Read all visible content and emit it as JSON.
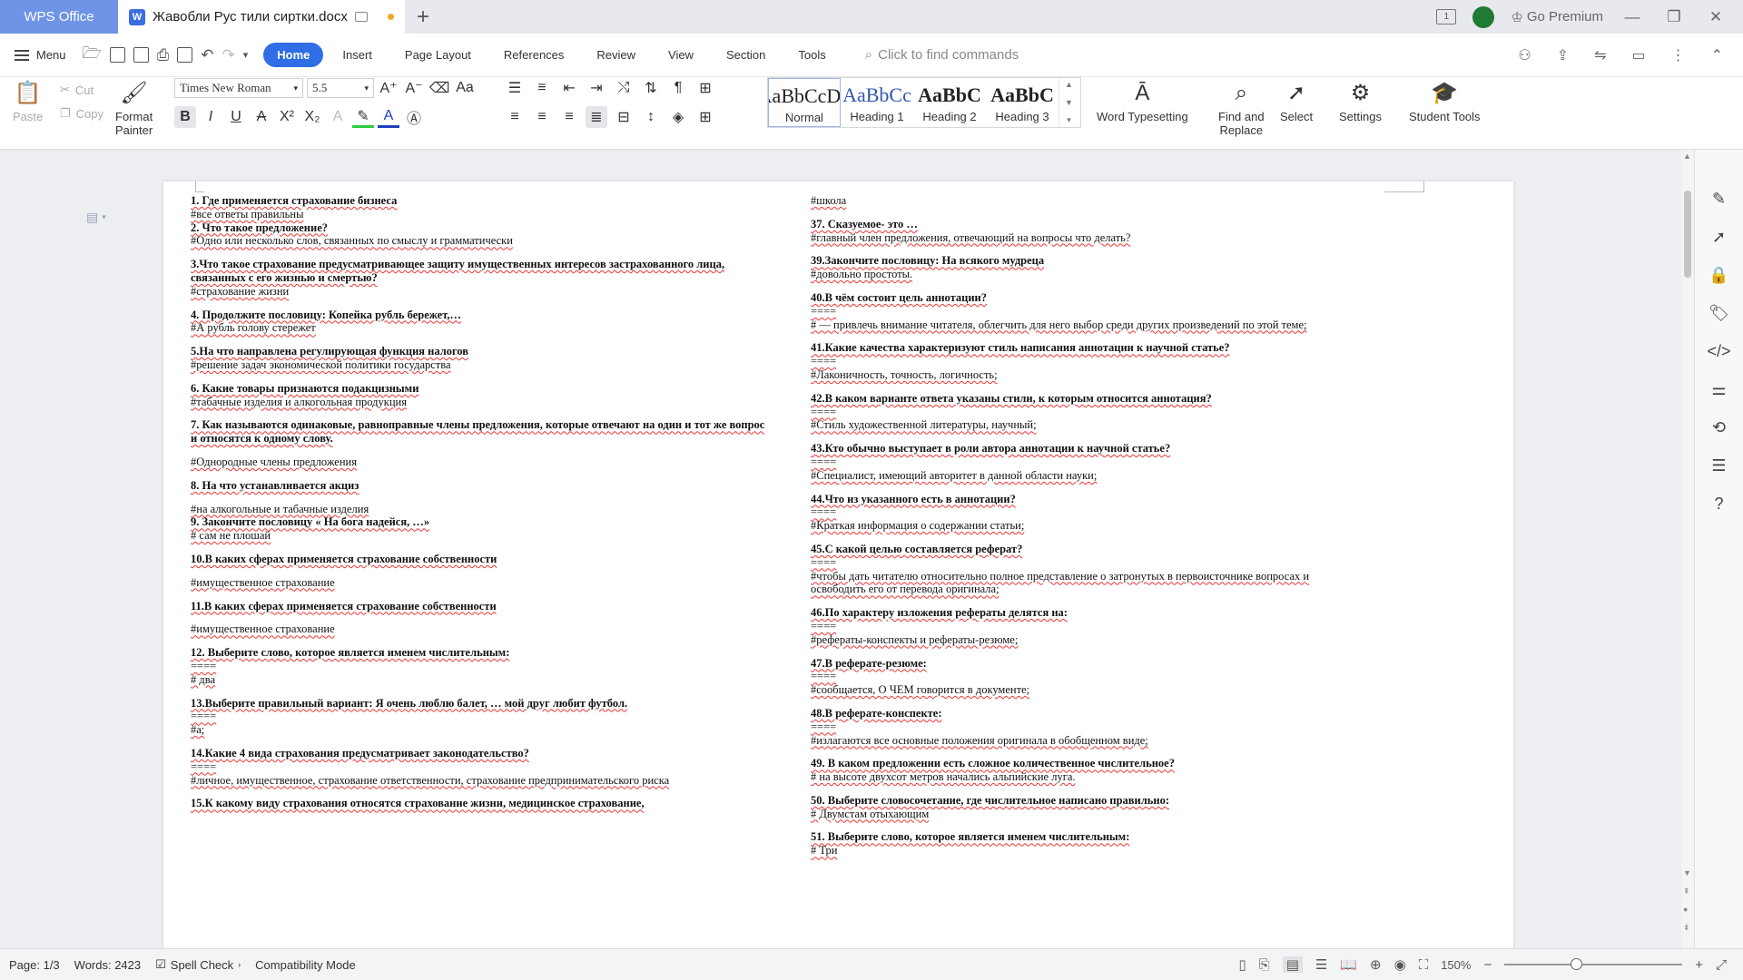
{
  "titlebar": {
    "app_tab": "WPS Office",
    "doc_tab": "Жавобли Рус тили сиртки.docx",
    "premium": "Go Premium"
  },
  "menubar": {
    "menu_label": "Menu",
    "tabs": [
      "Home",
      "Insert",
      "Page Layout",
      "References",
      "Review",
      "View",
      "Section",
      "Tools"
    ],
    "active_tab": "Home",
    "find_placeholder": "Click to find commands"
  },
  "ribbon": {
    "paste": "Paste",
    "cut": "Cut",
    "copy": "Copy",
    "format_painter_line1": "Format",
    "format_painter_line2": "Painter",
    "font_name": "Times New Roman",
    "font_size": "5.5",
    "styles": [
      {
        "sample": "AaBbCcDd",
        "label": "Normal"
      },
      {
        "sample": "AaBbCc",
        "label": "Heading 1"
      },
      {
        "sample": "AaBbC",
        "label": "Heading 2"
      },
      {
        "sample": "AaBbC",
        "label": "Heading 3"
      }
    ],
    "word_typesetting": "Word Typesetting",
    "find_replace_line1": "Find and",
    "find_replace_line2": "Replace",
    "select": "Select",
    "settings": "Settings",
    "student_tools": "Student Tools"
  },
  "document": {
    "left_column": [
      {
        "t": "q",
        "text": "1. Где применяется страхование бизнеса"
      },
      {
        "t": "a",
        "text": "#все ответы правильны"
      },
      {
        "t": "q",
        "text": "2. Что такое предложение?"
      },
      {
        "t": "a",
        "text": "#Одно или несколько слов, связанных по смыслу и грамматически"
      },
      {
        "t": "gap"
      },
      {
        "t": "q",
        "text": "3.Что такое страхование предусматривающее защиту имущественных интересов застрахованного лица, связанных с его жизнью и смертью?"
      },
      {
        "t": "a",
        "text": "#страхование жизни"
      },
      {
        "t": "gap"
      },
      {
        "t": "q",
        "text": "4. Продолжите пословицу: Копейка рубль бережет,…"
      },
      {
        "t": "a",
        "text": "#А рубль голову стережет"
      },
      {
        "t": "gap"
      },
      {
        "t": "q",
        "text": "5.На что направлена регулирующая функция налогов"
      },
      {
        "t": "a",
        "text": "#решение задач экономической политики государства"
      },
      {
        "t": "gap"
      },
      {
        "t": "q",
        "text": "6. Какие товары признаются подакцизными"
      },
      {
        "t": "a",
        "text": "#табачные изделия и алкогольная продукция"
      },
      {
        "t": "gap"
      },
      {
        "t": "q",
        "text": "7. Как называются одинаковые, равноправные члены предложения, которые отвечают на один и тот же вопрос и относятся к одному слову."
      },
      {
        "t": "gap"
      },
      {
        "t": "a",
        "text": "#Однородные члены предложения"
      },
      {
        "t": "gap"
      },
      {
        "t": "q",
        "text": "8. На что устанавливается акциз"
      },
      {
        "t": "gap"
      },
      {
        "t": "a",
        "text": "#на алкогольные и табачные изделия"
      },
      {
        "t": "q",
        "text": "9. Закончите пословицу « На бога надейся, …»"
      },
      {
        "t": "a",
        "text": "# сам не плошай"
      },
      {
        "t": "gap"
      },
      {
        "t": "q",
        "text": "10.В каких сферах применяется страхование собственности"
      },
      {
        "t": "gap"
      },
      {
        "t": "a",
        "text": "#имущественное страхование"
      },
      {
        "t": "gap"
      },
      {
        "t": "q",
        "text": "11.В каких сферах применяется страхование собственности"
      },
      {
        "t": "gap"
      },
      {
        "t": "a",
        "text": "#имущественное страхование"
      },
      {
        "t": "gap"
      },
      {
        "t": "q",
        "text": "12. Выберите слово, которое является именем числительным:"
      },
      {
        "t": "a",
        "text": "===="
      },
      {
        "t": "a",
        "text": "# два"
      },
      {
        "t": "gap"
      },
      {
        "t": "q",
        "text": "13.Выберите правильный вариант: Я очень люблю балет, … мой друг любит футбол."
      },
      {
        "t": "a",
        "text": "===="
      },
      {
        "t": "a",
        "text": "#а;"
      },
      {
        "t": "gap"
      },
      {
        "t": "q",
        "text": "14.Какие 4 вида страхования предусматривает законодательство?"
      },
      {
        "t": "a",
        "text": "===="
      },
      {
        "t": "a",
        "text": "#личное, имущественное, страхование ответственности, страхование предпринимательского риска"
      },
      {
        "t": "gap"
      },
      {
        "t": "q",
        "text": "15.К какому виду страхования относятся страхование жизни, медицинское страхование,"
      }
    ],
    "right_column": [
      {
        "t": "a",
        "text": "#школа"
      },
      {
        "t": "gap"
      },
      {
        "t": "q",
        "text": "37. Сказуемое- это …"
      },
      {
        "t": "a",
        "text": " #главный член предложения, отвечающий на вопросы что делать?"
      },
      {
        "t": "gap"
      },
      {
        "t": "q",
        "text": "39.Закончите пословицу: На всякого мудреца"
      },
      {
        "t": "a",
        "text": "#довольно простоты."
      },
      {
        "t": "gap"
      },
      {
        "t": "q",
        "text": "40.В чём состоит цель аннотации?"
      },
      {
        "t": "a",
        "text": "===="
      },
      {
        "t": "a",
        "text": "# — привлечь внимание читателя, облегчить для него выбор среди других произведений по этой теме;"
      },
      {
        "t": "gap"
      },
      {
        "t": "q",
        "text": "41.Какие качества характеризуют стиль написания аннотации к научной статье?"
      },
      {
        "t": "a",
        "text": "===="
      },
      {
        "t": "a",
        "text": "#Лаконичность, точность, логичность;"
      },
      {
        "t": "gap"
      },
      {
        "t": "q",
        "text": "42.В каком варианте ответа указаны стили, к которым относится аннотация?"
      },
      {
        "t": "a",
        "text": "===="
      },
      {
        "t": "a",
        "text": "#Стиль художественной литературы, научный;"
      },
      {
        "t": "gap"
      },
      {
        "t": "q",
        "text": "43.Кто обычно выступает в роли автора аннотации к научной статье?"
      },
      {
        "t": "a",
        "text": "===="
      },
      {
        "t": "a",
        "text": "#Специалист, имеющий авторитет в данной области науки;"
      },
      {
        "t": "gap"
      },
      {
        "t": "q",
        "text": "44.Что из указанного есть в аннотации?"
      },
      {
        "t": "a",
        "text": "===="
      },
      {
        "t": "a",
        "text": "#Краткая информация о содержании статьи;"
      },
      {
        "t": "gap"
      },
      {
        "t": "q",
        "text": "45.С какой целью составляется реферат?"
      },
      {
        "t": "a",
        "text": "===="
      },
      {
        "t": "a",
        "text": "#чтобы дать читателю относительно полное представление о затронутых в первоисточнике вопросах и освободить его от перевода оригинала;"
      },
      {
        "t": "gap"
      },
      {
        "t": "q",
        "text": "46.По характеру изложения рефераты делятся на:"
      },
      {
        "t": "a",
        "text": "===="
      },
      {
        "t": "a",
        "text": "#рефераты-конспекты и рефераты-резюме;"
      },
      {
        "t": "gap"
      },
      {
        "t": "q",
        "text": "47.В реферате-резюме:"
      },
      {
        "t": "a",
        "text": "===="
      },
      {
        "t": "a",
        "text": "#сообщается, О ЧЕМ говорится в документе;"
      },
      {
        "t": "gap"
      },
      {
        "t": "q",
        "text": "48.В реферате-конспекте:"
      },
      {
        "t": "a",
        "text": "===="
      },
      {
        "t": "a",
        "text": "#излагаются все основные положения оригинала в обобщенном виде;"
      },
      {
        "t": "gap"
      },
      {
        "t": "q",
        "text": "49. В каком предложении есть сложное количественное числительное?"
      },
      {
        "t": "a",
        "text": "# на высоте двухсот метров начались альпийские луга."
      },
      {
        "t": "gap"
      },
      {
        "t": "q",
        "text": "50. Выберите словосочетание, где числительное написано правильно:"
      },
      {
        "t": "a",
        "text": "# Двумстам отыхающим"
      },
      {
        "t": "gap"
      },
      {
        "t": "q",
        "text": "51. Выберите слово, которое является именем числительным:"
      },
      {
        "t": "a",
        "text": "# Три"
      }
    ]
  },
  "statusbar": {
    "page": "Page: 1/3",
    "words": "Words: 2423",
    "spell_check": "Spell Check",
    "compat": "Compatibility Mode",
    "zoom": "150%",
    "zoom_level": 0.4
  },
  "colors": {
    "accent": "#2f6ee5",
    "app_tab": "#6f93e6",
    "unsaved_dot": "#f5a623"
  }
}
